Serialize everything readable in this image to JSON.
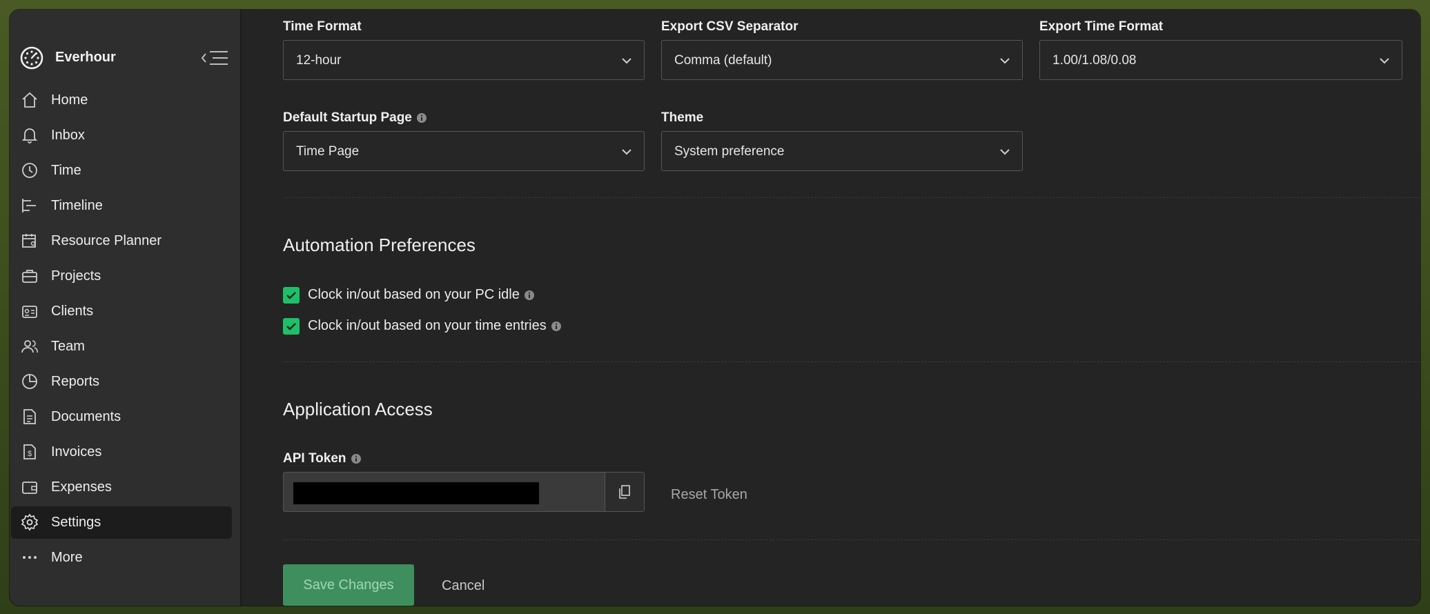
{
  "app": {
    "name": "Everhour"
  },
  "sidebar": {
    "items": [
      {
        "label": "Home",
        "icon": "home-icon"
      },
      {
        "label": "Inbox",
        "icon": "bell-icon"
      },
      {
        "label": "Time",
        "icon": "clock-icon"
      },
      {
        "label": "Timeline",
        "icon": "timeline-icon"
      },
      {
        "label": "Resource Planner",
        "icon": "calendar-person-icon"
      },
      {
        "label": "Projects",
        "icon": "briefcase-icon"
      },
      {
        "label": "Clients",
        "icon": "id-card-icon"
      },
      {
        "label": "Team",
        "icon": "people-icon"
      },
      {
        "label": "Reports",
        "icon": "pie-chart-icon"
      },
      {
        "label": "Documents",
        "icon": "document-icon"
      },
      {
        "label": "Invoices",
        "icon": "invoice-icon"
      },
      {
        "label": "Expenses",
        "icon": "wallet-icon"
      },
      {
        "label": "Settings",
        "icon": "gear-icon",
        "active": true
      },
      {
        "label": "More",
        "icon": "more-dots-icon"
      }
    ]
  },
  "preferences": {
    "time_format": {
      "label": "Time Format",
      "value": "12-hour"
    },
    "csv_separator": {
      "label": "Export CSV Separator",
      "value": "Comma (default)"
    },
    "export_time_format": {
      "label": "Export Time Format",
      "value": "1.00/1.08/0.08"
    },
    "startup_page": {
      "label": "Default Startup Page",
      "value": "Time Page"
    },
    "theme": {
      "label": "Theme",
      "value": "System preference"
    }
  },
  "automation": {
    "title": "Automation Preferences",
    "options": [
      {
        "label": "Clock in/out based on your PC idle",
        "checked": true
      },
      {
        "label": "Clock in/out based on your time entries",
        "checked": true
      }
    ]
  },
  "access": {
    "title": "Application Access",
    "token_label": "API Token",
    "reset_label": "Reset Token"
  },
  "actions": {
    "save": "Save Changes",
    "cancel": "Cancel"
  },
  "colors": {
    "accent": "#1fbf6a",
    "save_button": "#3f8f5e",
    "background": "#242424",
    "sidebar": "#2e2e2e"
  }
}
